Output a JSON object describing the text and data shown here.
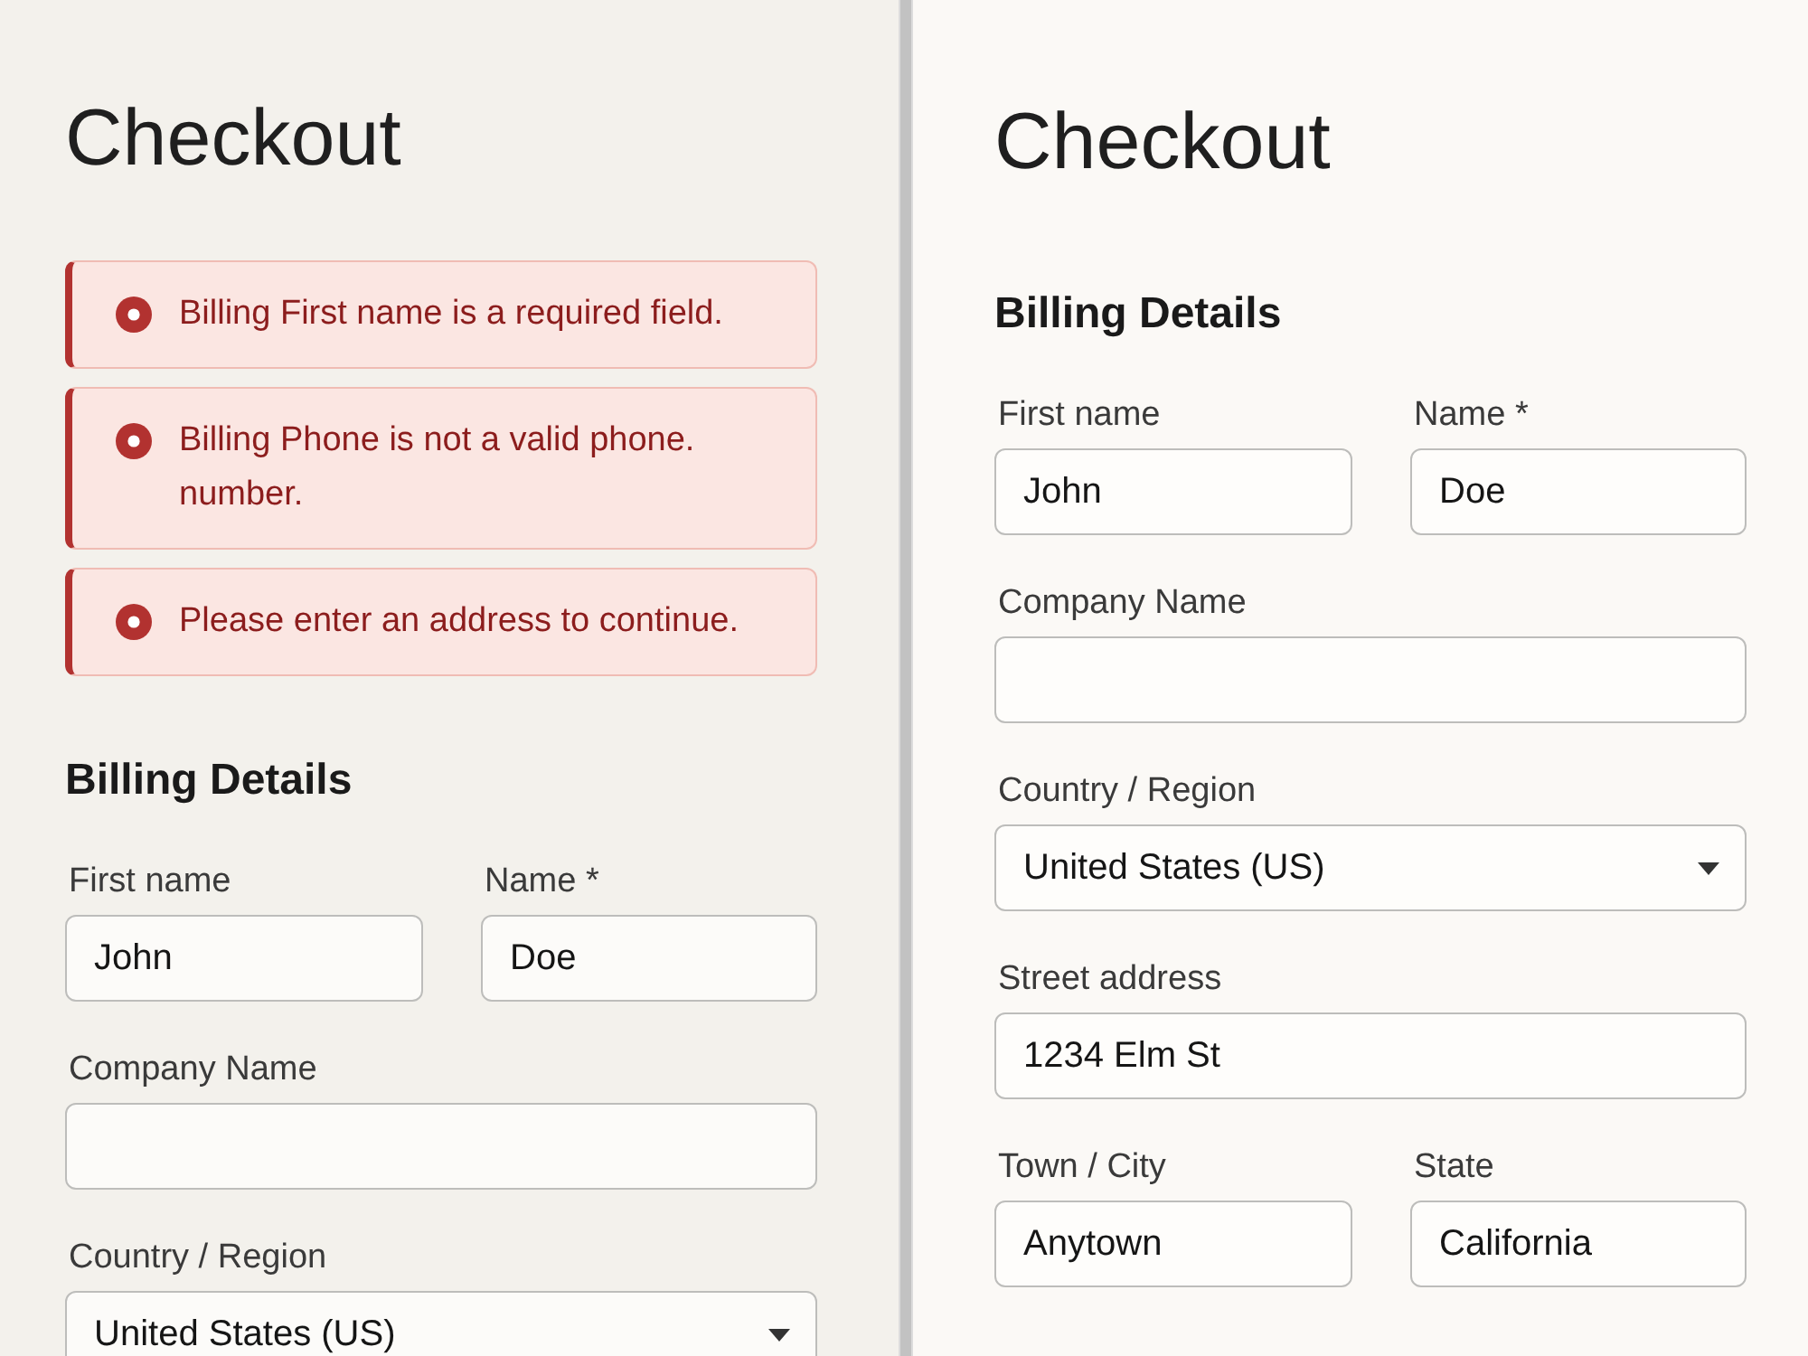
{
  "panels": [
    {
      "title": "Checkout",
      "notices": [
        {
          "text": "Billing First name is a required field."
        },
        {
          "text": "Billing Phone is not a valid phone. number."
        },
        {
          "text": "Please enter an address to continue."
        }
      ],
      "section": "Billing Details",
      "rows": [
        {
          "fields": [
            {
              "kind": "text",
              "label": "First name",
              "value": "John"
            },
            {
              "kind": "text",
              "label": "Name *",
              "value": "Doe"
            }
          ]
        },
        {
          "fields": [
            {
              "kind": "text",
              "label": "Company Name"
            }
          ]
        },
        {
          "fields": [
            {
              "kind": "select",
              "label": "Country / Region",
              "value": "United States (US)"
            }
          ]
        }
      ]
    },
    {
      "title": "Checkout",
      "section": "Billing Details",
      "rows": [
        {
          "fields": [
            {
              "kind": "text",
              "label": "First name",
              "value": "John"
            },
            {
              "kind": "text",
              "label": "Name *",
              "value": "Doe"
            }
          ]
        },
        {
          "fields": [
            {
              "kind": "text",
              "label": "Company Name"
            }
          ]
        },
        {
          "fields": [
            {
              "kind": "select",
              "label": "Country / Region",
              "value": "United States (US)"
            }
          ]
        },
        {
          "fields": [
            {
              "kind": "text",
              "label": "Street address",
              "value": "1234 Elm St"
            }
          ]
        },
        {
          "fields": [
            {
              "kind": "text",
              "label": "Town / City",
              "value": "Anytown"
            },
            {
              "kind": "text",
              "label": "State",
              "value": "California"
            }
          ]
        }
      ]
    }
  ]
}
